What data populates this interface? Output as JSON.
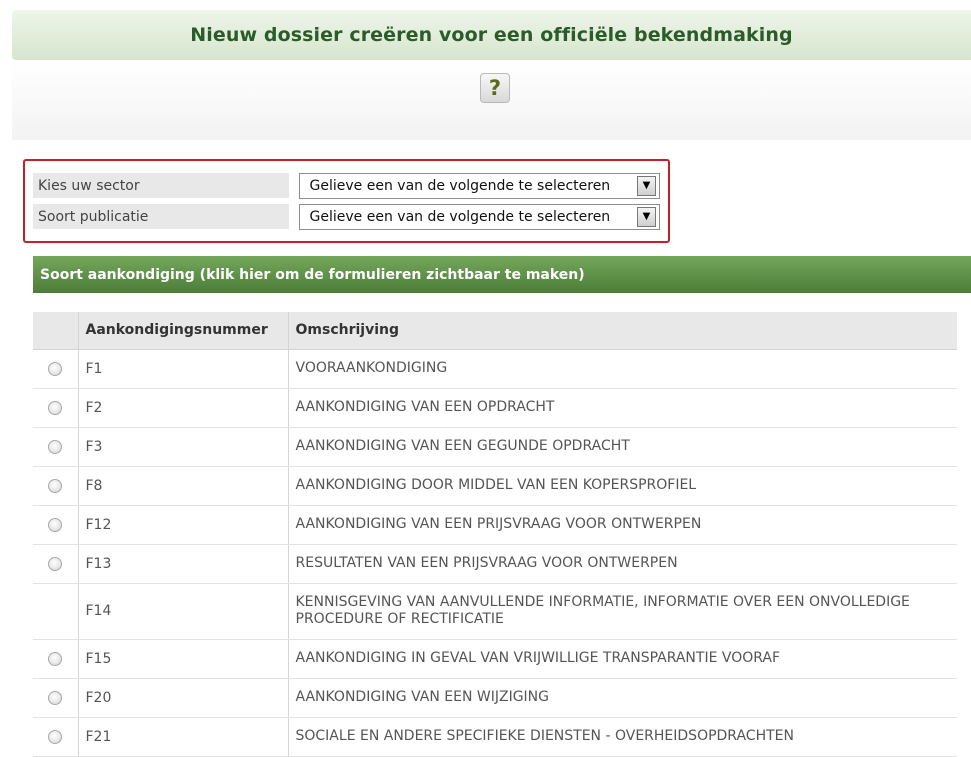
{
  "header": {
    "title": "Nieuw dossier creëren voor een officiële bekendmaking",
    "help_label": "?"
  },
  "selectors": [
    {
      "label": "Kies uw sector",
      "value": "Gelieve een van de volgende te selecteren"
    },
    {
      "label": "Soort publicatie",
      "value": "Gelieve een van de volgende te selecteren"
    }
  ],
  "section": {
    "title": "Soort aankondiging (klik hier om de formulieren zichtbaar te maken)"
  },
  "table": {
    "headers": [
      "",
      "Aankondigingsnummer",
      "Omschrijving"
    ],
    "rows": [
      {
        "number": "F1",
        "description": "VOORAANKONDIGING",
        "has_radio": true
      },
      {
        "number": "F2",
        "description": "AANKONDIGING VAN EEN OPDRACHT",
        "has_radio": true
      },
      {
        "number": "F3",
        "description": "AANKONDIGING VAN EEN GEGUNDE OPDRACHT",
        "has_radio": true
      },
      {
        "number": "F8",
        "description": "AANKONDIGING DOOR MIDDEL VAN EEN KOPERSPROFIEL",
        "has_radio": true
      },
      {
        "number": "F12",
        "description": "AANKONDIGING VAN EEN PRIJSVRAAG VOOR ONTWERPEN",
        "has_radio": true
      },
      {
        "number": "F13",
        "description": "RESULTATEN VAN EEN PRIJSVRAAG VOOR ONTWERPEN",
        "has_radio": true
      },
      {
        "number": "F14",
        "description": "KENNISGEVING VAN AANVULLENDE INFORMATIE, INFORMATIE OVER EEN ONVOLLEDIGE PROCEDURE OF RECTIFICATIE",
        "has_radio": false
      },
      {
        "number": "F15",
        "description": "AANKONDIGING IN GEVAL VAN VRIJWILLIGE TRANSPARANTIE VOORAF",
        "has_radio": true
      },
      {
        "number": "F20",
        "description": "AANKONDIGING VAN EEN WIJZIGING",
        "has_radio": true
      },
      {
        "number": "F21",
        "description": "SOCIALE EN ANDERE SPECIFIEKE DIENSTEN - OVERHEIDSOPDRACHTEN",
        "has_radio": true
      }
    ]
  },
  "icons": {
    "help": "question-mark-icon",
    "dropdown": "chevron-down-icon",
    "radio": "radio-button-icon"
  },
  "colors": {
    "header_text": "#2c5b2a",
    "section_bar": "#5a8c45",
    "selector_border": "#c42026"
  }
}
